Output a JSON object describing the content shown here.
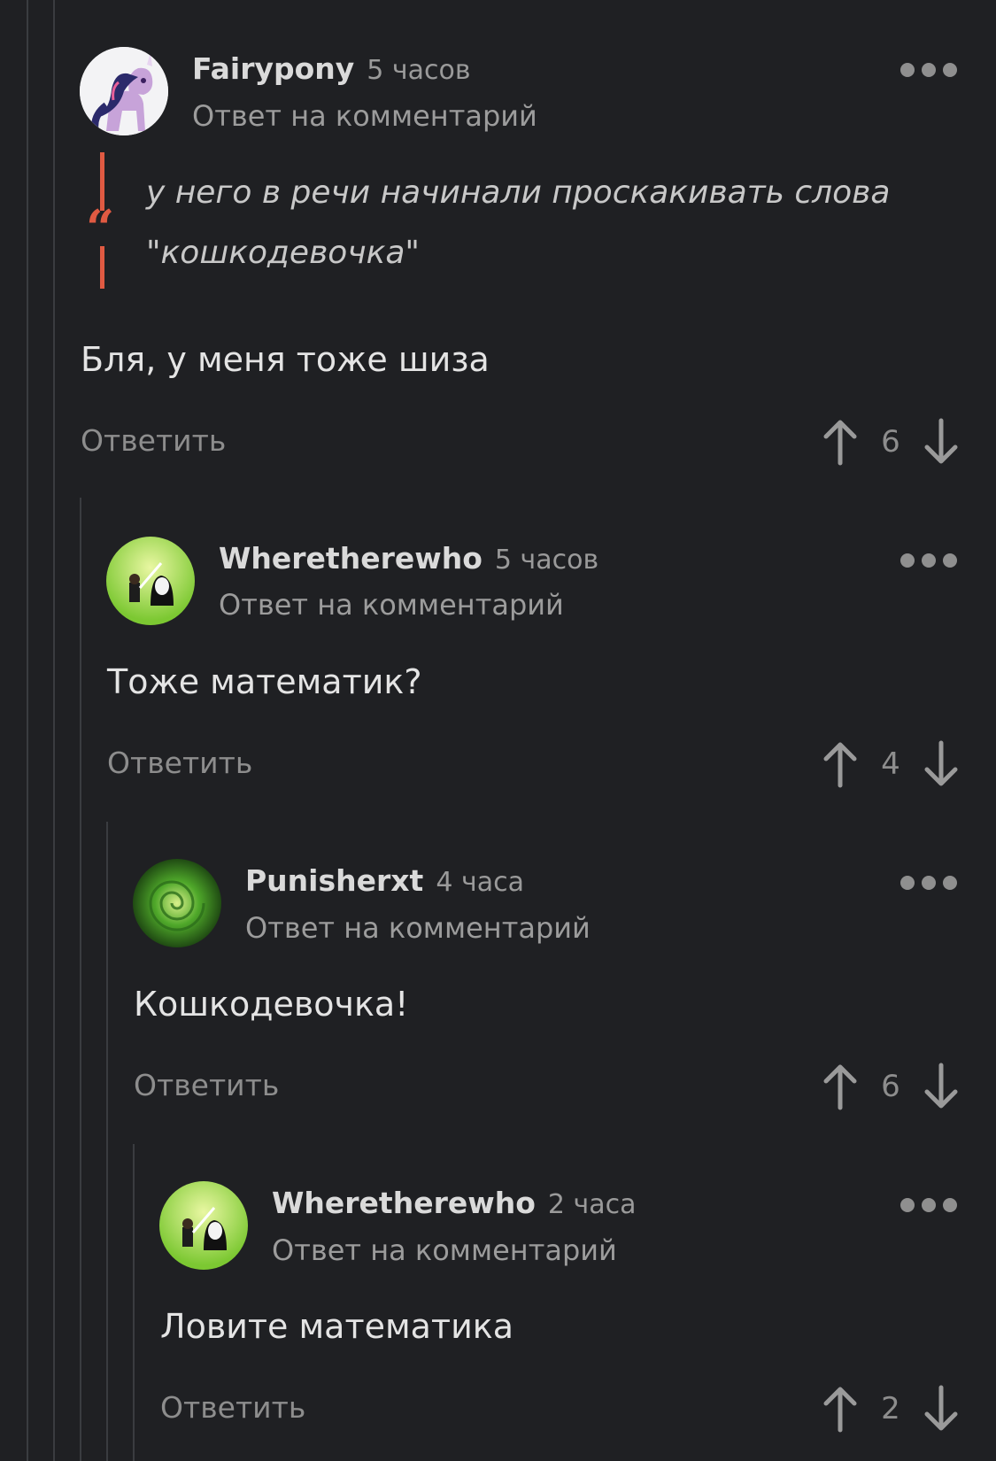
{
  "comments": [
    {
      "author": "Fairypony",
      "time": "5 часов",
      "reply_to_label": "Ответ на комментарий",
      "avatar_icon": "pony-avatar",
      "quote_line1": "у него в речи начинали проскакивать слова",
      "quote_line2": "\"кошкодевочка\"",
      "text": "Бля, у меня тоже шиза",
      "reply_button": "Ответить",
      "score": "6"
    },
    {
      "author": "Wheretherewho",
      "time": "5 часов",
      "reply_to_label": "Ответ на комментарий",
      "avatar_icon": "sword-character-avatar",
      "text": "Тоже математик?",
      "reply_button": "Ответить",
      "score": "4"
    },
    {
      "author": "Punisherxt",
      "time": "4 часа",
      "reply_to_label": "Ответ на комментарий",
      "avatar_icon": "green-portal-avatar",
      "text": "Кошкодевочка!",
      "reply_button": "Ответить",
      "score": "6"
    },
    {
      "author": "Wheretherewho",
      "time": "2 часа",
      "reply_to_label": "Ответ на комментарий",
      "avatar_icon": "sword-character-avatar",
      "text": "Ловите математика",
      "reply_button": "Ответить",
      "score": "2"
    }
  ],
  "colors": {
    "background": "#1f2023",
    "quote_accent": "#e05a42",
    "thread_line": "#3a3c40"
  }
}
